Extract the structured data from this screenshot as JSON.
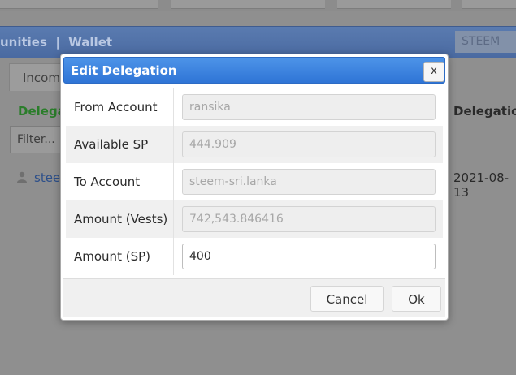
{
  "background": {
    "nav_text": "unities  |  Wallet",
    "steem_label": "STEEM",
    "tab_income": "Incom",
    "col_delegator": "Delega",
    "col_delegation": "Delegation",
    "filter_placeholder": "Filter...",
    "row_user": "stee",
    "row_date": "2021-08-13"
  },
  "dialog": {
    "title": "Edit Delegation",
    "close_label": "x",
    "fields": [
      {
        "label": "From Account",
        "value": "ransika"
      },
      {
        "label": "Available SP",
        "value": "444.909"
      },
      {
        "label": "To Account",
        "value": "steem-sri.lanka"
      },
      {
        "label": "Amount (Vests)",
        "value": "742,543.846416"
      },
      {
        "label": "Amount (SP)",
        "value": "400"
      }
    ],
    "cancel_label": "Cancel",
    "ok_label": "Ok"
  },
  "colors": {
    "title_bar": "#2f75d6",
    "nav_bar": "#4a6aa1",
    "delegator_header": "#2a7d2a"
  }
}
